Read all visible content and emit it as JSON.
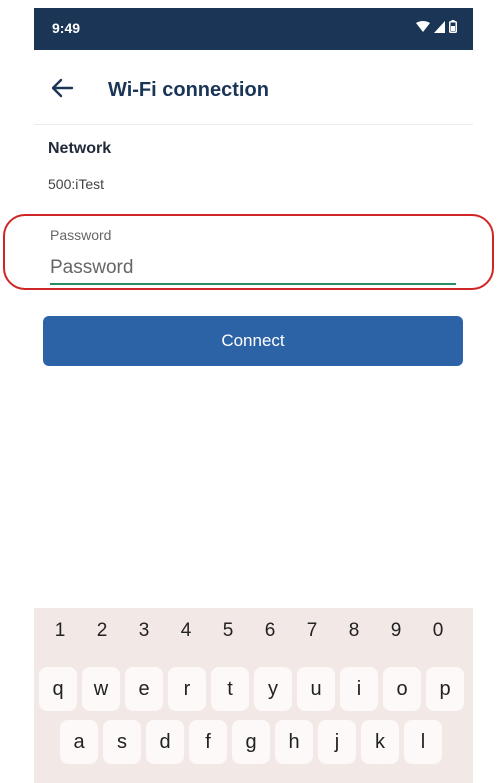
{
  "status_bar": {
    "time": "9:49",
    "icons": [
      "wifi-icon",
      "signal-icon",
      "battery-icon"
    ]
  },
  "app_bar": {
    "title": "Wi-Fi connection",
    "back_icon": "arrow-left-icon"
  },
  "network": {
    "label": "Network",
    "value": "500:iTest"
  },
  "password": {
    "label": "Password",
    "placeholder": "Password",
    "value": ""
  },
  "connect_button": {
    "label": "Connect"
  },
  "keyboard": {
    "numbers": [
      "1",
      "2",
      "3",
      "4",
      "5",
      "6",
      "7",
      "8",
      "9",
      "0"
    ],
    "row1": [
      "q",
      "w",
      "e",
      "r",
      "t",
      "y",
      "u",
      "i",
      "o",
      "p"
    ],
    "row2": [
      "a",
      "s",
      "d",
      "f",
      "g",
      "h",
      "j",
      "k",
      "l"
    ]
  },
  "colors": {
    "status_bar": "#1b3557",
    "title": "#1b3557",
    "button": "#2c63a6",
    "input_underline": "#2a8c63",
    "highlight": "#d12424",
    "keyboard_bg": "#f2e8e6"
  }
}
